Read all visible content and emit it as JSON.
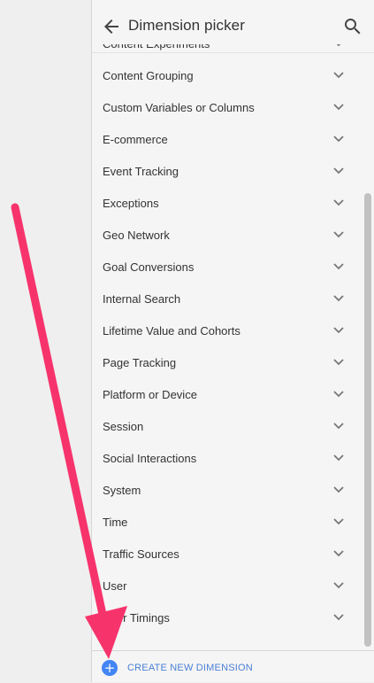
{
  "header": {
    "title": "Dimension picker",
    "back_icon": "arrow-back-icon",
    "search_icon": "search-icon"
  },
  "dimensions": [
    "Content Experiments",
    "Content Grouping",
    "Custom Variables or Columns",
    "E-commerce",
    "Event Tracking",
    "Exceptions",
    "Geo Network",
    "Goal Conversions",
    "Internal Search",
    "Lifetime Value and Cohorts",
    "Page Tracking",
    "Platform or Device",
    "Session",
    "Social Interactions",
    "System",
    "Time",
    "Traffic Sources",
    "User",
    "User Timings"
  ],
  "footer": {
    "create_label": "CREATE NEW DIMENSION",
    "plus": "+"
  },
  "colors": {
    "accent": "#4285f4",
    "annotation_arrow": "#f7336c"
  }
}
